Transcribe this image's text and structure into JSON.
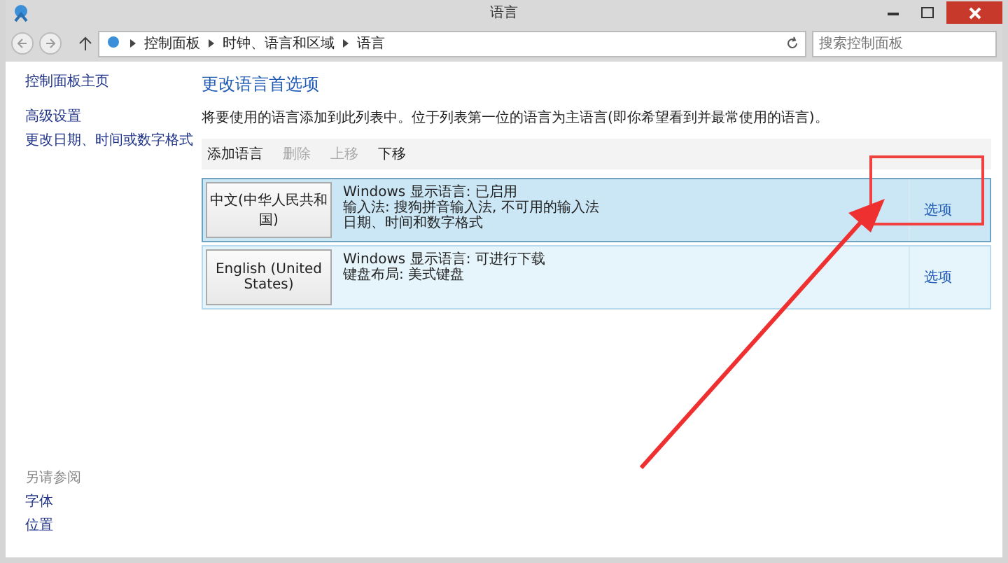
{
  "window": {
    "title": "语言"
  },
  "breadcrumbs": [
    "控制面板",
    "时钟、语言和区域",
    "语言"
  ],
  "search": {
    "placeholder": "搜索控制面板"
  },
  "sidebar": {
    "items": [
      "控制面板主页",
      "高级设置",
      "更改日期、时间或数字格式"
    ],
    "see_also_title": "另请参阅",
    "see_also": [
      "字体",
      "位置"
    ]
  },
  "heading": "更改语言首选项",
  "description": "将要使用的语言添加到此列表中。位于列表第一位的语言为主语言(即你希望看到并最常使用的语言)。",
  "toolbar": [
    {
      "label": "添加语言",
      "disabled": false
    },
    {
      "label": "删除",
      "disabled": true
    },
    {
      "label": "上移",
      "disabled": true
    },
    {
      "label": "下移",
      "disabled": false
    }
  ],
  "languages": [
    {
      "name": "中文(中华人民共和国)",
      "details": [
        "Windows 显示语言: 已启用",
        "输入法: 搜狗拼音输入法, 不可用的输入法",
        "日期、时间和数字格式"
      ],
      "options": "选项",
      "selected": true
    },
    {
      "name": "English (United States)",
      "details": [
        "Windows 显示语言: 可进行下载",
        "键盘布局: 美式键盘"
      ],
      "options": "选项",
      "selected": false
    }
  ]
}
